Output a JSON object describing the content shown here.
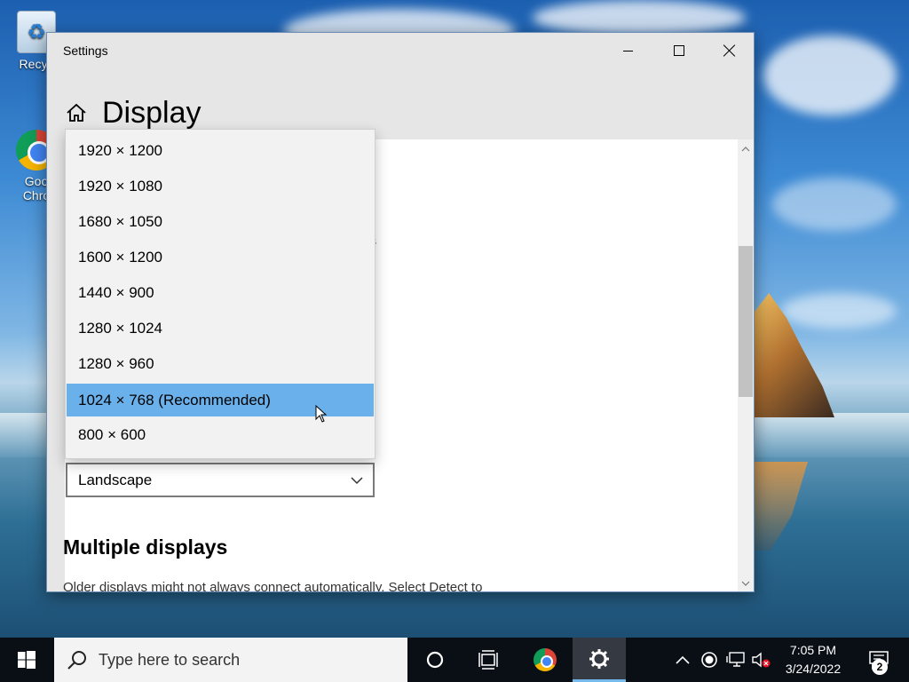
{
  "desktop": {
    "icons": [
      {
        "label": "Recycle Bin",
        "visible_label": "Recyc"
      },
      {
        "label": "Google Chrome",
        "visible_label_line1": "Goo",
        "visible_label_line2": "Chro"
      }
    ]
  },
  "window": {
    "title": "Settings",
    "page_title": "Display",
    "stray_text": "s",
    "orientation_value": "Landscape",
    "section_heading": "Multiple displays",
    "cut_text": "Older displays might not always connect automatically. Select Detect to"
  },
  "dropdown": {
    "items": [
      {
        "label": "1920 × 1200",
        "selected": false
      },
      {
        "label": "1920 × 1080",
        "selected": false
      },
      {
        "label": "1680 × 1050",
        "selected": false
      },
      {
        "label": "1600 × 1200",
        "selected": false
      },
      {
        "label": "1440 × 900",
        "selected": false
      },
      {
        "label": "1280 × 1024",
        "selected": false
      },
      {
        "label": "1280 × 960",
        "selected": false
      },
      {
        "label": "1024 × 768 (Recommended)",
        "selected": true
      },
      {
        "label": "800 × 600",
        "selected": false
      }
    ]
  },
  "taskbar": {
    "search_placeholder": "Type here to search",
    "time": "7:05 PM",
    "date": "3/24/2022",
    "notification_count": "2"
  },
  "colors": {
    "selected_item": "#6ab0ea",
    "taskbar": "#0a0f16",
    "active_indicator": "#76b9ed"
  }
}
